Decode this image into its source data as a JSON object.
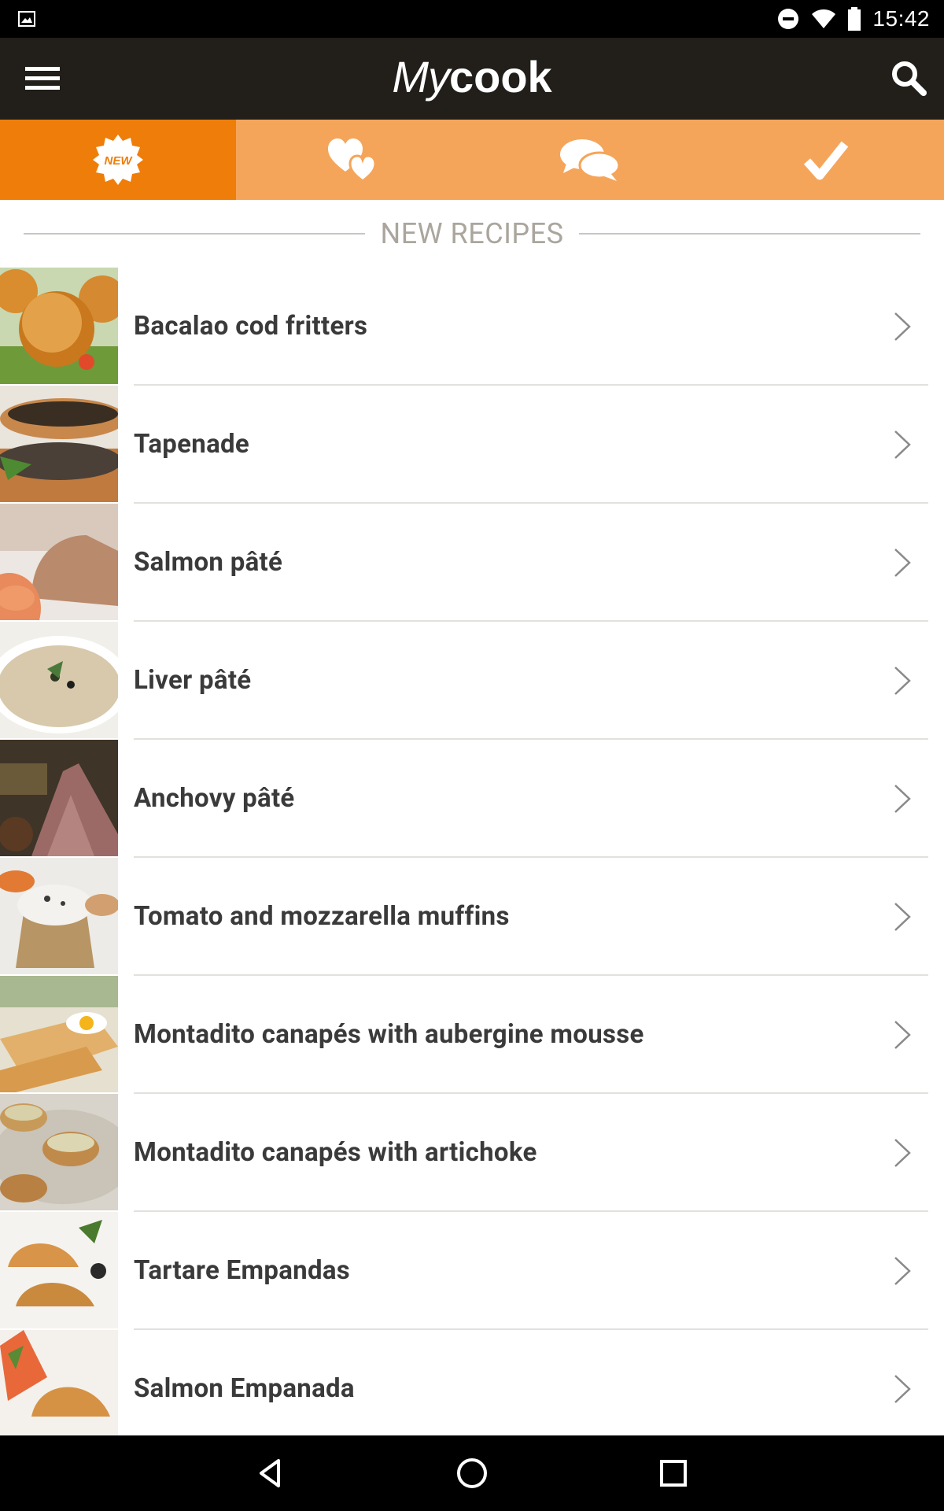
{
  "status_bar": {
    "time": "15:42",
    "icons": [
      "image-icon",
      "do-not-disturb-icon",
      "wifi-icon",
      "battery-icon"
    ]
  },
  "app_bar": {
    "logo_my": "My",
    "logo_cook": "cook",
    "menu_icon": "hamburger-menu-icon",
    "search_icon": "search-icon"
  },
  "tabs": [
    {
      "icon": "new-badge-icon",
      "badge_text": "NEW",
      "active": true
    },
    {
      "icon": "hearts-icon",
      "active": false
    },
    {
      "icon": "chat-bubbles-icon",
      "active": false
    },
    {
      "icon": "checkmark-icon",
      "active": false
    }
  ],
  "section": {
    "title": "NEW RECIPES"
  },
  "recipes": [
    {
      "title": "Bacalao cod fritters"
    },
    {
      "title": "Tapenade"
    },
    {
      "title": "Salmon pâté"
    },
    {
      "title": "Liver pâté"
    },
    {
      "title": "Anchovy pâté"
    },
    {
      "title": "Tomato and mozzarella muffins"
    },
    {
      "title": "Montadito canapés with aubergine mousse"
    },
    {
      "title": "Montadito canapés with artichoke"
    },
    {
      "title": "Tartare Empandas"
    },
    {
      "title": "Salmon Empanada"
    }
  ],
  "colors": {
    "tab_active": "#ef7d0a",
    "tab_inactive": "#f5a55a",
    "app_bar": "#221f1b",
    "text": "#3a3a3a"
  },
  "nav_bar": {
    "icons": [
      "back-icon",
      "home-icon",
      "recents-icon"
    ]
  }
}
